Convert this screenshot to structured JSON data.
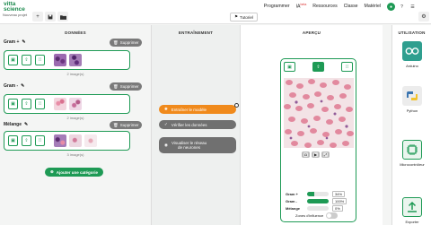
{
  "app": {
    "brand_line1": "vitta",
    "brand_line2": "science",
    "project_name": "Nouveau projet"
  },
  "toolbar": {
    "new": "+",
    "save": "💾",
    "open": "📂"
  },
  "tutorial_label": "Tutoriel",
  "nav": {
    "programmer": "Programmer",
    "ia": "IA",
    "ia_badge": "beta",
    "ressources": "Ressources",
    "classe": "Classe",
    "materiel": "Matériel"
  },
  "columns": {
    "data": "DONNÉES",
    "training": "ENTRAÎNEMENT",
    "preview": "APERÇU",
    "usage": "UTILISATION"
  },
  "categories": [
    {
      "name": "Gram +",
      "delete_label": "Supprimer",
      "count_label": "2 image(s)"
    },
    {
      "name": "Gram -",
      "delete_label": "Supprimer",
      "count_label": "2 image(s)"
    },
    {
      "name": "Mélange",
      "delete_label": "Supprimer",
      "count_label": "3 image(s)"
    }
  ],
  "add_category_label": "Ajouter une catégorie",
  "training": {
    "train_label": "Entraîner le modèle",
    "verify_label": "Vérifier les données",
    "network_label_1": "Visualiser le réseau",
    "network_label_2": "de neurones"
  },
  "results": [
    {
      "label": "Gram +",
      "value": 34,
      "display": "34%"
    },
    {
      "label": "Gram -",
      "value": 100,
      "display": "100%"
    },
    {
      "label": "Mélange",
      "value": 0,
      "display": "0%"
    }
  ],
  "influence_label": "Zones d'influence",
  "usage": [
    {
      "label": "Arduino",
      "color": "#2f9f8f",
      "icon": "arduino-icon"
    },
    {
      "label": "Python",
      "color": "#e7e7e7",
      "icon": "python-icon"
    },
    {
      "label": "Microcontrôleur",
      "color": "#e9f5ec",
      "icon": "chip-icon"
    },
    {
      "label": "Exporter",
      "color": "#e9f5ec",
      "icon": "export-icon"
    }
  ],
  "colors": {
    "accent": "#1e9a55",
    "train": "#f08a1c",
    "secondary": "#707070"
  }
}
